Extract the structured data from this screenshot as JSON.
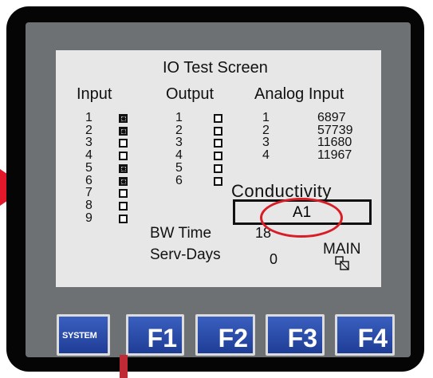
{
  "screen": {
    "title": "IO Test Screen",
    "input": {
      "header": "Input",
      "rows": [
        {
          "n": "1",
          "on": true
        },
        {
          "n": "2",
          "on": true
        },
        {
          "n": "3",
          "on": false
        },
        {
          "n": "4",
          "on": false
        },
        {
          "n": "5",
          "on": true
        },
        {
          "n": "6",
          "on": true
        },
        {
          "n": "7",
          "on": false
        },
        {
          "n": "8",
          "on": false
        },
        {
          "n": "9",
          "on": false
        }
      ]
    },
    "output": {
      "header": "Output",
      "rows": [
        {
          "n": "1",
          "on": false
        },
        {
          "n": "2",
          "on": false
        },
        {
          "n": "3",
          "on": false
        },
        {
          "n": "4",
          "on": false
        },
        {
          "n": "5",
          "on": false
        },
        {
          "n": "6",
          "on": false
        }
      ]
    },
    "analog": {
      "header": "Analog Input",
      "rows": [
        {
          "n": "1",
          "value": "6897"
        },
        {
          "n": "2",
          "value": "57739"
        },
        {
          "n": "3",
          "value": "11680"
        },
        {
          "n": "4",
          "value": "11967"
        }
      ]
    },
    "conductivity": {
      "label": "Conductivity",
      "value": "A1"
    },
    "bw_time": {
      "label": "BW Time",
      "value": "18"
    },
    "serv_days": {
      "label": "Serv-Days",
      "value": "0"
    },
    "main_label": "MAIN"
  },
  "buttons": {
    "system": "SYSTEM",
    "f1": "F1",
    "f2": "F2",
    "f3": "F3",
    "f4": "F4"
  },
  "colors": {
    "screen_bg": "#e7e7e7",
    "panel": "#6e7173",
    "button_blue": "#2a4daa",
    "highlight_red": "#d81d26"
  }
}
